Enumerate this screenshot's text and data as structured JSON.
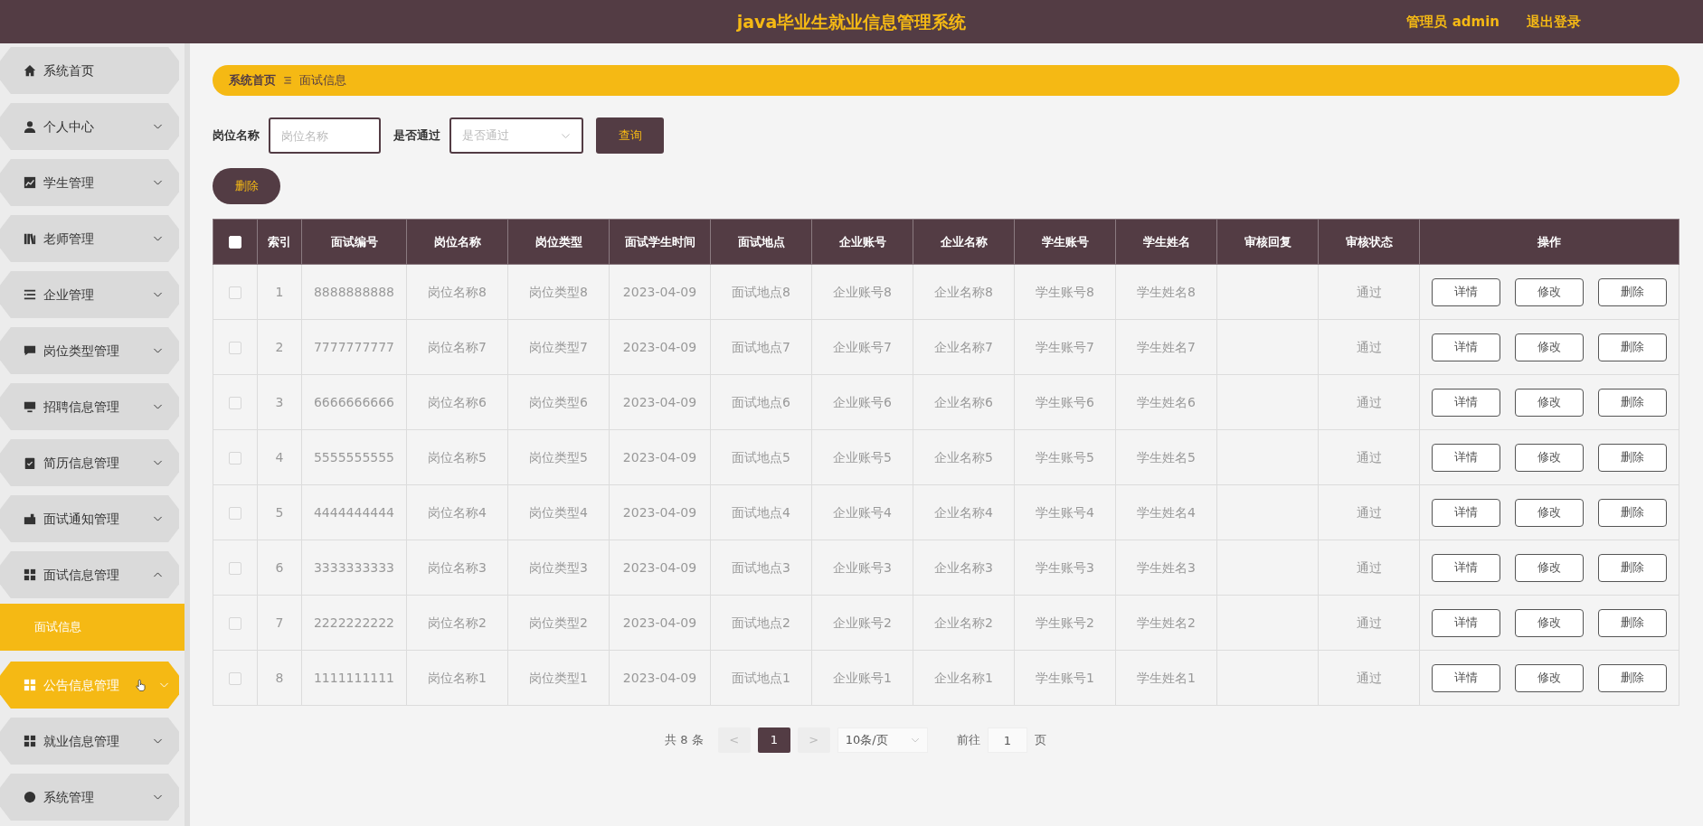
{
  "header": {
    "title": "java毕业生就业信息管理系统",
    "user": "管理员 admin",
    "logout": "退出登录"
  },
  "sidebar": {
    "items": [
      {
        "label": "系统首页",
        "kind": "link",
        "hovered": false
      },
      {
        "label": "个人中心",
        "kind": "group",
        "expanded": false,
        "hovered": false
      },
      {
        "label": "学生管理",
        "kind": "group",
        "expanded": false,
        "hovered": false
      },
      {
        "label": "老师管理",
        "kind": "group",
        "expanded": false,
        "hovered": false
      },
      {
        "label": "企业管理",
        "kind": "group",
        "expanded": false,
        "hovered": false
      },
      {
        "label": "岗位类型管理",
        "kind": "group",
        "expanded": false,
        "hovered": false
      },
      {
        "label": "招聘信息管理",
        "kind": "group",
        "expanded": false,
        "hovered": false
      },
      {
        "label": "简历信息管理",
        "kind": "group",
        "expanded": false,
        "hovered": false
      },
      {
        "label": "面试通知管理",
        "kind": "group",
        "expanded": false,
        "hovered": false
      },
      {
        "label": "面试信息管理",
        "kind": "group",
        "expanded": true,
        "hovered": false,
        "children": [
          {
            "label": "面试信息",
            "selected": true
          }
        ]
      },
      {
        "label": "公告信息管理",
        "kind": "group",
        "expanded": false,
        "hovered": true
      },
      {
        "label": "就业信息管理",
        "kind": "group",
        "expanded": false,
        "hovered": false
      },
      {
        "label": "系统管理",
        "kind": "group",
        "expanded": false,
        "hovered": false
      }
    ]
  },
  "breadcrumb": [
    "系统首页",
    "面试信息"
  ],
  "search": {
    "fields": [
      {
        "label": "岗位名称",
        "kind": "input",
        "placeholder": "岗位名称"
      },
      {
        "label": "是否通过",
        "kind": "select",
        "placeholder": "是否通过"
      }
    ],
    "button": "查询"
  },
  "actions": [
    "删除"
  ],
  "table": {
    "select_all": {
      "checked": false
    },
    "columns": [
      "索引",
      "面试编号",
      "岗位名称",
      "岗位类型",
      "面试学生时间",
      "面试地点",
      "企业账号",
      "企业名称",
      "学生账号",
      "学生姓名",
      "审核回复",
      "审核状态",
      "操作"
    ],
    "rows": [
      {
        "checked": false,
        "cells": [
          "1",
          "8888888888",
          "岗位名称8",
          "岗位类型8",
          "2023-04-09",
          "面试地点8",
          "企业账号8",
          "企业名称8",
          "学生账号8",
          "学生姓名8"
        ],
        "status": "通过",
        "ops": [
          "详情",
          "修改",
          "删除"
        ]
      },
      {
        "checked": false,
        "cells": [
          "2",
          "7777777777",
          "岗位名称7",
          "岗位类型7",
          "2023-04-09",
          "面试地点7",
          "企业账号7",
          "企业名称7",
          "学生账号7",
          "学生姓名7"
        ],
        "status": "通过",
        "ops": [
          "详情",
          "修改",
          "删除"
        ]
      },
      {
        "checked": false,
        "cells": [
          "3",
          "6666666666",
          "岗位名称6",
          "岗位类型6",
          "2023-04-09",
          "面试地点6",
          "企业账号6",
          "企业名称6",
          "学生账号6",
          "学生姓名6"
        ],
        "status": "通过",
        "ops": [
          "详情",
          "修改",
          "删除"
        ]
      },
      {
        "checked": false,
        "cells": [
          "4",
          "5555555555",
          "岗位名称5",
          "岗位类型5",
          "2023-04-09",
          "面试地点5",
          "企业账号5",
          "企业名称5",
          "学生账号5",
          "学生姓名5"
        ],
        "status": "通过",
        "ops": [
          "详情",
          "修改",
          "删除"
        ]
      },
      {
        "checked": false,
        "cells": [
          "5",
          "4444444444",
          "岗位名称4",
          "岗位类型4",
          "2023-04-09",
          "面试地点4",
          "企业账号4",
          "企业名称4",
          "学生账号4",
          "学生姓名4"
        ],
        "status": "通过",
        "ops": [
          "详情",
          "修改",
          "删除"
        ]
      },
      {
        "checked": false,
        "cells": [
          "6",
          "3333333333",
          "岗位名称3",
          "岗位类型3",
          "2023-04-09",
          "面试地点3",
          "企业账号3",
          "企业名称3",
          "学生账号3",
          "学生姓名3"
        ],
        "status": "通过",
        "ops": [
          "详情",
          "修改",
          "删除"
        ]
      },
      {
        "checked": false,
        "cells": [
          "7",
          "2222222222",
          "岗位名称2",
          "岗位类型2",
          "2023-04-09",
          "面试地点2",
          "企业账号2",
          "企业名称2",
          "学生账号2",
          "学生姓名2"
        ],
        "status": "通过",
        "ops": [
          "详情",
          "修改",
          "删除"
        ]
      },
      {
        "checked": false,
        "cells": [
          "8",
          "1111111111",
          "岗位名称1",
          "岗位类型1",
          "2023-04-09",
          "面试地点1",
          "企业账号1",
          "企业名称1",
          "学生账号1",
          "学生姓名1"
        ],
        "status": "通过",
        "ops": [
          "详情",
          "修改",
          "删除"
        ]
      }
    ]
  },
  "pagination": {
    "total": "共 8 条",
    "prev": "<",
    "pages": [
      {
        "label": "1",
        "selected": true
      }
    ],
    "next": ">",
    "page_size": "10条/页",
    "goto_label": "前往",
    "goto_value": "1",
    "goto_suffix": "页"
  }
}
